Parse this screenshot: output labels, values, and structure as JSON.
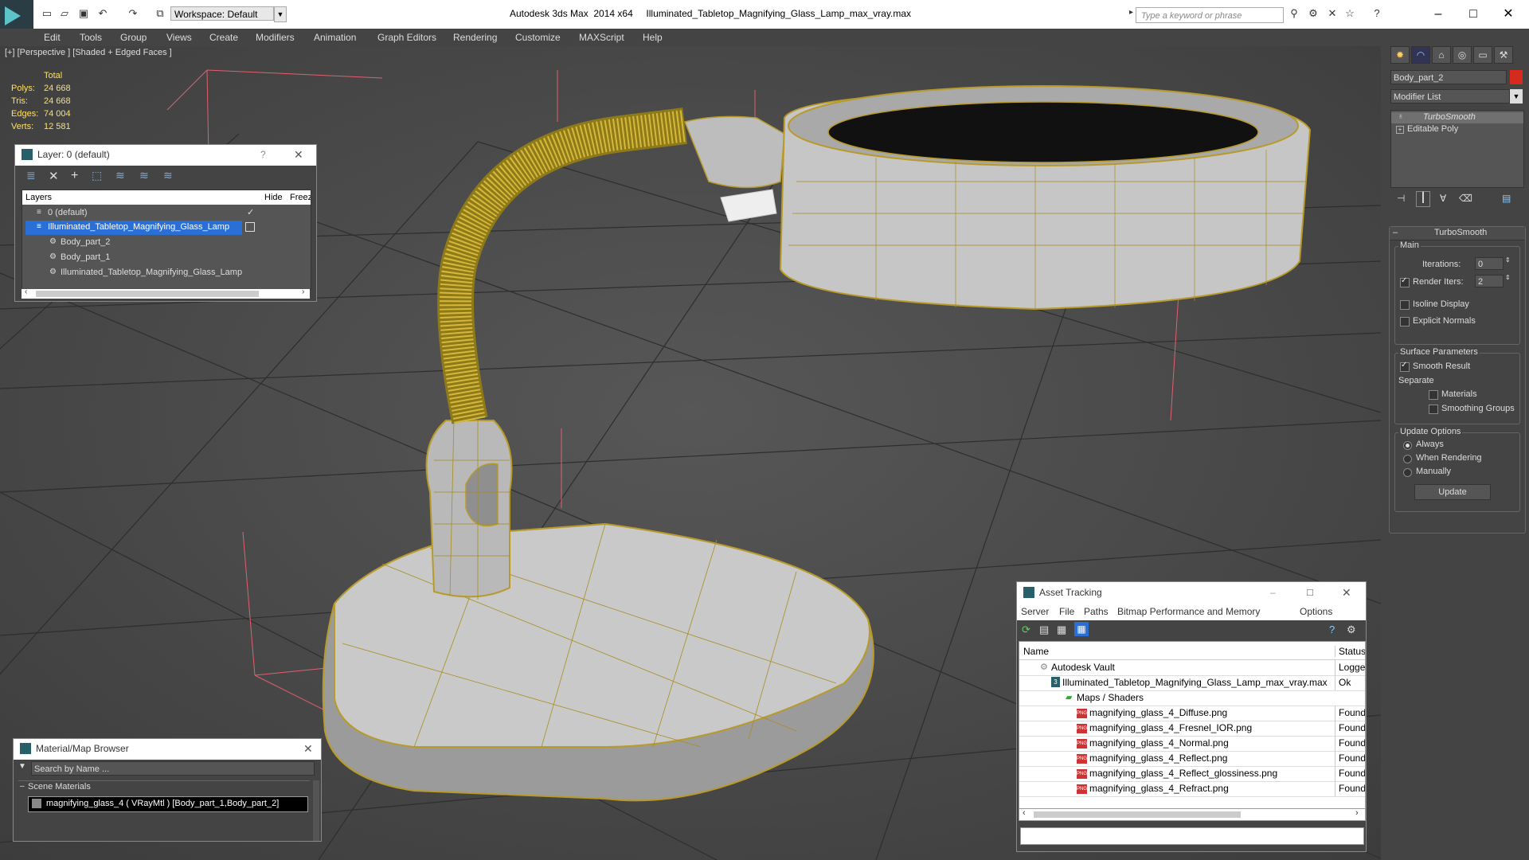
{
  "app": {
    "title": "Autodesk 3ds Max  2014 x64     Illuminated_Tabletop_Magnifying_Glass_Lamp_max_vray.max",
    "workspace": "Workspace: Default",
    "search_placeholder": "Type a keyword or phrase"
  },
  "menu": [
    "Edit",
    "Tools",
    "Group",
    "Views",
    "Create",
    "Modifiers",
    "Animation",
    "Graph Editors",
    "Rendering",
    "Customize",
    "MAXScript",
    "Help"
  ],
  "viewport": {
    "label": "[+] [Perspective ] [Shaded + Edged Faces ]",
    "stats": {
      "header": "Total",
      "rows": [
        {
          "label": "Polys:",
          "value": "24 668"
        },
        {
          "label": "Tris:",
          "value": "24 668"
        },
        {
          "label": "Edges:",
          "value": "74 004"
        },
        {
          "label": "Verts:",
          "value": "12 581"
        }
      ]
    }
  },
  "layer_panel": {
    "title": "Layer: 0 (default)",
    "help": "?",
    "columns": {
      "layers": "Layers",
      "hide": "Hide",
      "freeze": "Freeze"
    },
    "rows": [
      {
        "name": "0 (default)",
        "indent": 1
      },
      {
        "name": "Illuminated_Tabletop_Magnifying_Glass_Lamp",
        "indent": 1,
        "selected": true
      },
      {
        "name": "Body_part_2",
        "indent": 2
      },
      {
        "name": "Body_part_1",
        "indent": 2
      },
      {
        "name": "Illuminated_Tabletop_Magnifying_Glass_Lamp",
        "indent": 2
      }
    ]
  },
  "material_browser": {
    "title": "Material/Map Browser",
    "search_placeholder": "Search by Name ...",
    "section": "Scene Materials",
    "item": "magnifying_glass_4  ( VRayMtl ) [Body_part_1,Body_part_2]"
  },
  "command_panel": {
    "object_name": "Body_part_2",
    "modifier_list": "Modifier List",
    "stack": [
      "TurboSmooth",
      "Editable Poly"
    ],
    "rollout_title": "TurboSmooth",
    "main_label": "Main",
    "iterations_label": "Iterations:",
    "iterations_value": "0",
    "render_iters_label": "Render Iters:",
    "render_iters_value": "2",
    "isoline": "Isoline Display",
    "explicit_normals": "Explicit Normals",
    "surface_params": "Surface Parameters",
    "smooth_result": "Smooth Result",
    "separate": "Separate",
    "materials": "Materials",
    "smoothing_groups": "Smoothing Groups",
    "update_options": "Update Options",
    "always": "Always",
    "when_rendering": "When Rendering",
    "manually": "Manually",
    "update_button": "Update",
    "color_swatch": "#d52b1e"
  },
  "asset_tracking": {
    "title": "Asset Tracking",
    "menu": [
      "Server",
      "File",
      "Paths",
      "Bitmap Performance and Memory",
      "Options"
    ],
    "columns": {
      "name": "Name",
      "status": "Status"
    },
    "rows": [
      {
        "name": "Autodesk Vault",
        "status": "Logge",
        "indent": 1,
        "icon": "vault"
      },
      {
        "name": "Illuminated_Tabletop_Magnifying_Glass_Lamp_max_vray.max",
        "status": "Ok",
        "indent": 2,
        "icon": "max"
      },
      {
        "name": "Maps / Shaders",
        "status": "",
        "indent": 3,
        "icon": "folder"
      },
      {
        "name": "magnifying_glass_4_Diffuse.png",
        "status": "Found",
        "indent": 4,
        "icon": "png"
      },
      {
        "name": "magnifying_glass_4_Fresnel_IOR.png",
        "status": "Found",
        "indent": 4,
        "icon": "png"
      },
      {
        "name": "magnifying_glass_4_Normal.png",
        "status": "Found",
        "indent": 4,
        "icon": "png"
      },
      {
        "name": "magnifying_glass_4_Reflect.png",
        "status": "Found",
        "indent": 4,
        "icon": "png"
      },
      {
        "name": "magnifying_glass_4_Reflect_glossiness.png",
        "status": "Found",
        "indent": 4,
        "icon": "png"
      },
      {
        "name": "magnifying_glass_4_Refract.png",
        "status": "Found",
        "indent": 4,
        "icon": "png"
      }
    ]
  }
}
